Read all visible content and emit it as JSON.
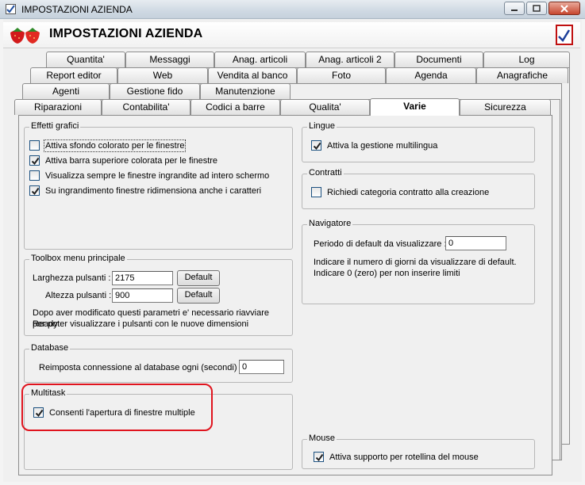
{
  "window": {
    "title": "IMPOSTAZIONI AZIENDA"
  },
  "header": {
    "title": "IMPOSTAZIONI AZIENDA"
  },
  "tabs": {
    "row1": [
      "Quantita'",
      "Messaggi",
      "Anag. articoli",
      "Anag. articoli 2",
      "Documenti",
      "Log"
    ],
    "row2": [
      "Report editor",
      "Web",
      "Vendita al banco",
      "Foto",
      "Agenda",
      "Anagrafiche"
    ],
    "row3": [
      "Agenti",
      "Gestione fido",
      "Manutenzione"
    ],
    "row4": [
      "Riparazioni",
      "Contabilita'",
      "Codici a barre",
      "Qualita'",
      "Varie",
      "Sicurezza"
    ],
    "active": "Varie"
  },
  "effetti": {
    "legend": "Effetti grafici",
    "items": [
      {
        "label": "Attiva sfondo colorato per le finestre",
        "checked": false
      },
      {
        "label": "Attiva barra superiore colorata per le finestre",
        "checked": true
      },
      {
        "label": "Visualizza sempre le finestre ingrandite ad intero schermo",
        "checked": false
      },
      {
        "label": "Su ingrandimento finestre ridimensiona anche i caratteri",
        "checked": true
      }
    ]
  },
  "toolbox": {
    "legend": "Toolbox menu principale",
    "width_label": "Larghezza pulsanti :",
    "width_value": "2175",
    "height_label": "Altezza pulsanti :",
    "height_value": "900",
    "default_label": "Default",
    "note_line1": "Dopo aver modificato questi parametri e' necessario riavviare Ready",
    "note_line2": "per poter visualizzare i pulsanti con le nuove dimensioni"
  },
  "database": {
    "legend": "Database",
    "label": "Reimposta connessione al database ogni (secondi) :",
    "value": "0"
  },
  "multitask": {
    "legend": "Multitask",
    "label": "Consenti l'apertura di finestre multiple",
    "checked": true
  },
  "lingue": {
    "legend": "Lingue",
    "label": "Attiva la gestione multilingua",
    "checked": true
  },
  "contratti": {
    "legend": "Contratti",
    "label": "Richiedi categoria contratto alla creazione",
    "checked": false
  },
  "navigatore": {
    "legend": "Navigatore",
    "label": "Periodo di default da visualizzare :",
    "value": "0",
    "note_line1": "Indicare il numero di giorni da visualizzare di default.",
    "note_line2": "Indicare 0 (zero) per non inserire limiti"
  },
  "mouse": {
    "legend": "Mouse",
    "label": "Attiva supporto per rotellina del mouse",
    "checked": true
  },
  "colors": {
    "highlight": "#e0141e",
    "header_check": "#c01010"
  }
}
